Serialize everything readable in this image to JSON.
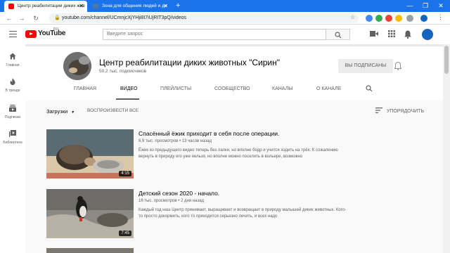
{
  "browser": {
    "tabs": [
      {
        "title": "Центр реабилитации диких жив",
        "favicon_color": "#ff0000",
        "active": true
      },
      {
        "title": "Зона для общения людей и ди",
        "favicon_color": "#4a76a8",
        "active": false
      }
    ],
    "new_tab_label": "+",
    "url": "youtube.com/channel/UCmnjcXjYHji8I7iUjRIT3pQ/videos",
    "window_controls": [
      "—",
      "❐",
      "✕"
    ]
  },
  "masthead": {
    "logo_text": "YouTube",
    "logo_region": "RU",
    "search_placeholder": "Введите запрос"
  },
  "guide": {
    "items": [
      {
        "label": "Главная",
        "icon": "home-icon"
      },
      {
        "label": "В тренде",
        "icon": "trending-icon"
      },
      {
        "label": "Подписки",
        "icon": "subscriptions-icon"
      },
      {
        "label": "Библиотека",
        "icon": "library-icon"
      }
    ]
  },
  "channel": {
    "name": "Центр реабилитации диких животных \"Сирин\"",
    "subscribers": "50,2 тыс. подписчиков",
    "subscribed_label": "ВЫ ПОДПИСАНЫ",
    "tabs": [
      "ГЛАВНАЯ",
      "ВИДЕО",
      "ПЛЕЙЛИСТЫ",
      "СООБЩЕСТВО",
      "КАНАЛЫ",
      "О КАНАЛЕ"
    ],
    "active_tab": "ВИДЕО"
  },
  "content": {
    "uploads_label": "Загрузки",
    "play_all_label": "ВОСПРОИЗВЕСТИ ВСЕ",
    "sort_label": "УПОРЯДОЧИТЬ",
    "videos": [
      {
        "title": "Спасённый ёжик приходит в себя после операции.",
        "views": "6,9 тыс. просмотров",
        "age": "13 часов назад",
        "description": "Ёжик из предыдущего видео теперь без лапки, но вполне бодр и учится ходить на трёх. К сожалению вернуть в природу его уже нельзя, но вполне можно поселить в вольере, возможно",
        "duration": "4:15"
      },
      {
        "title": "Детский сезон 2020 - начало.",
        "views": "16 тыс. просмотров",
        "age": "2 дня назад",
        "description": "Каждый год наш Центр принимает, выращивает и возвращает в природу малышей диких животных. Кого-то просто докормить, кого то приходится серьезно лечить, и всех надо",
        "duration": "7:45"
      }
    ],
    "meta_separator": "•"
  }
}
